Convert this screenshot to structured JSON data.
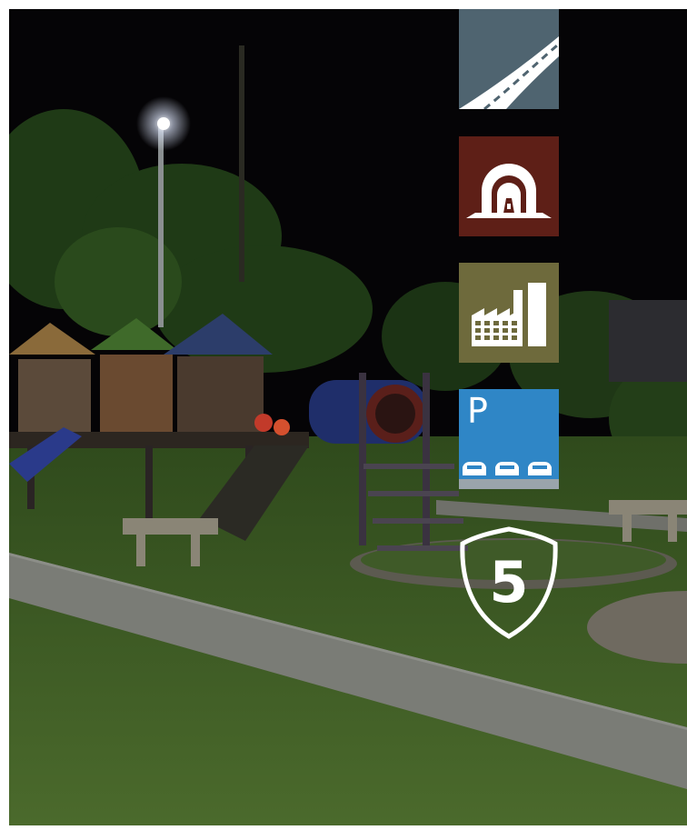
{
  "photo": {
    "subject": "night-playground",
    "colors": {
      "sky": "#050406",
      "grass": "#46602c",
      "path": "#7a7c76",
      "lamp": "#f4f7ff"
    }
  },
  "icons": [
    {
      "name": "road-icon",
      "background": "#4f6470"
    },
    {
      "name": "tunnel-icon",
      "background": "#5e1f17"
    },
    {
      "name": "industry-icon",
      "background": "#6e6a3c"
    },
    {
      "name": "parking-icon",
      "background": "#2f86c6"
    },
    {
      "name": "shield-icon",
      "background": "transparent"
    }
  ],
  "parking": {
    "letter": "P"
  },
  "shield": {
    "number": "5"
  }
}
